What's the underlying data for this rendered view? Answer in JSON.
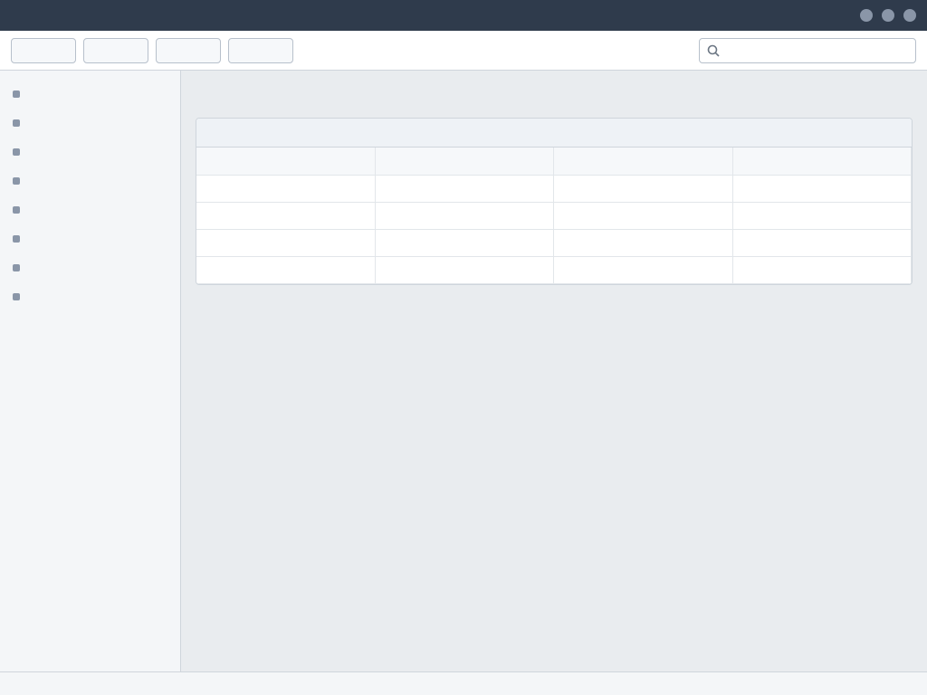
{
  "window": {
    "title": ""
  },
  "toolbar": {
    "buttons": [
      "",
      "",
      "",
      ""
    ],
    "search_placeholder": "",
    "search_value": ""
  },
  "sidebar": {
    "items": [
      "",
      "",
      "",
      "",
      "",
      "",
      "",
      ""
    ]
  },
  "main": {
    "page_title": "",
    "panel_title": "",
    "table": {
      "headers": [
        "",
        "",
        "",
        ""
      ],
      "rows": [
        [
          "",
          "",
          "",
          ""
        ],
        [
          "",
          "",
          "",
          ""
        ],
        [
          "",
          "",
          "",
          ""
        ],
        [
          "",
          "",
          "",
          ""
        ]
      ]
    }
  },
  "statusbar": {
    "left": "",
    "right": ""
  },
  "icons": {
    "search": "search-icon"
  }
}
